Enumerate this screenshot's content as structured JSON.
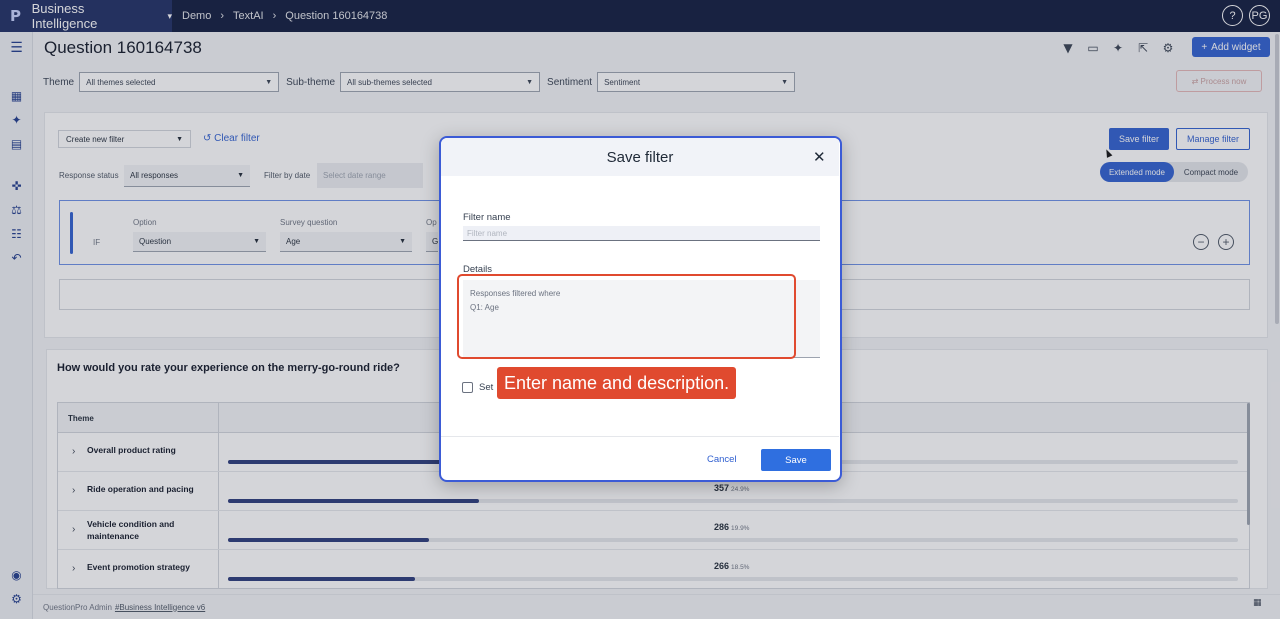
{
  "topbar": {
    "brand_logo": "P",
    "brand_name": "Business Intelligence",
    "brand_caret": "▾",
    "breadcrumbs": [
      "Demo",
      "TextAI",
      "Question 160164738"
    ],
    "breadcrumb_sep": "›",
    "help": "?",
    "user_initials": "PG"
  },
  "sidebar": {
    "icons": [
      "menu-icon",
      "dashboard-icon",
      "textai-icon",
      "report-icon",
      "puzzle-icon",
      "scale-icon",
      "list-icon",
      "back-icon",
      "user-shield-icon",
      "settings-icon"
    ]
  },
  "page": {
    "title": "Question 160164738",
    "add_widget": "Add widget",
    "add_widget_plus": "+",
    "process_now": "⇄  Process now"
  },
  "filters": {
    "theme_label": "Theme",
    "theme_value": "All themes selected",
    "subtheme_label": "Sub-theme",
    "subtheme_value": "All sub-themes selected",
    "sentiment_label": "Sentiment",
    "sentiment_placeholder": "Sentiment"
  },
  "filter_panel": {
    "create_new_filter": "Create new filter",
    "clear_filter": "↺ Clear filter",
    "response_status_label": "Response status",
    "response_status_value": "All responses",
    "filter_by_date_label": "Filter by date",
    "date_placeholder": "Select date range",
    "save_filter": "Save filter",
    "manage_filter": "Manage filter",
    "mode_extended": "Extended mode",
    "mode_compact": "Compact mode",
    "condition": {
      "if_label": "IF",
      "option_label": "Option",
      "option_value": "Question",
      "survey_question_label": "Survey question",
      "survey_question_value": "Age",
      "op_label": "Op",
      "op_value": "G"
    }
  },
  "card": {
    "title": "How would you rate your experience on the merry-go-round ride?",
    "column_header": "Theme",
    "rows": [
      {
        "name": "Overall product rating",
        "count": "",
        "pct": "",
        "fill": 0.22
      },
      {
        "name": "Ride operation and pacing",
        "count": "357",
        "pct": "24.9%",
        "fill": 0.249
      },
      {
        "name": "Vehicle condition and maintenance",
        "count": "286",
        "pct": "19.9%",
        "fill": 0.199
      },
      {
        "name": "Event promotion strategy",
        "count": "266",
        "pct": "18.5%",
        "fill": 0.185
      }
    ]
  },
  "footer": {
    "text": "QuestionPro Admin",
    "link": "#Business Intelligence v6"
  },
  "modal": {
    "title": "Save filter",
    "close": "✕",
    "filter_name_label": "Filter name",
    "filter_name_placeholder": "Filter name",
    "details_label": "Details",
    "details_line1": "Responses filtered where",
    "details_line2": "Q1: Age",
    "checkbox_label": "Set",
    "callout": "Enter name and description.",
    "cancel": "Cancel",
    "save": "Save"
  },
  "colors": {
    "primary": "#2f5fd0",
    "topbar": "#0f1a3d",
    "highlight": "#e04a2f"
  }
}
